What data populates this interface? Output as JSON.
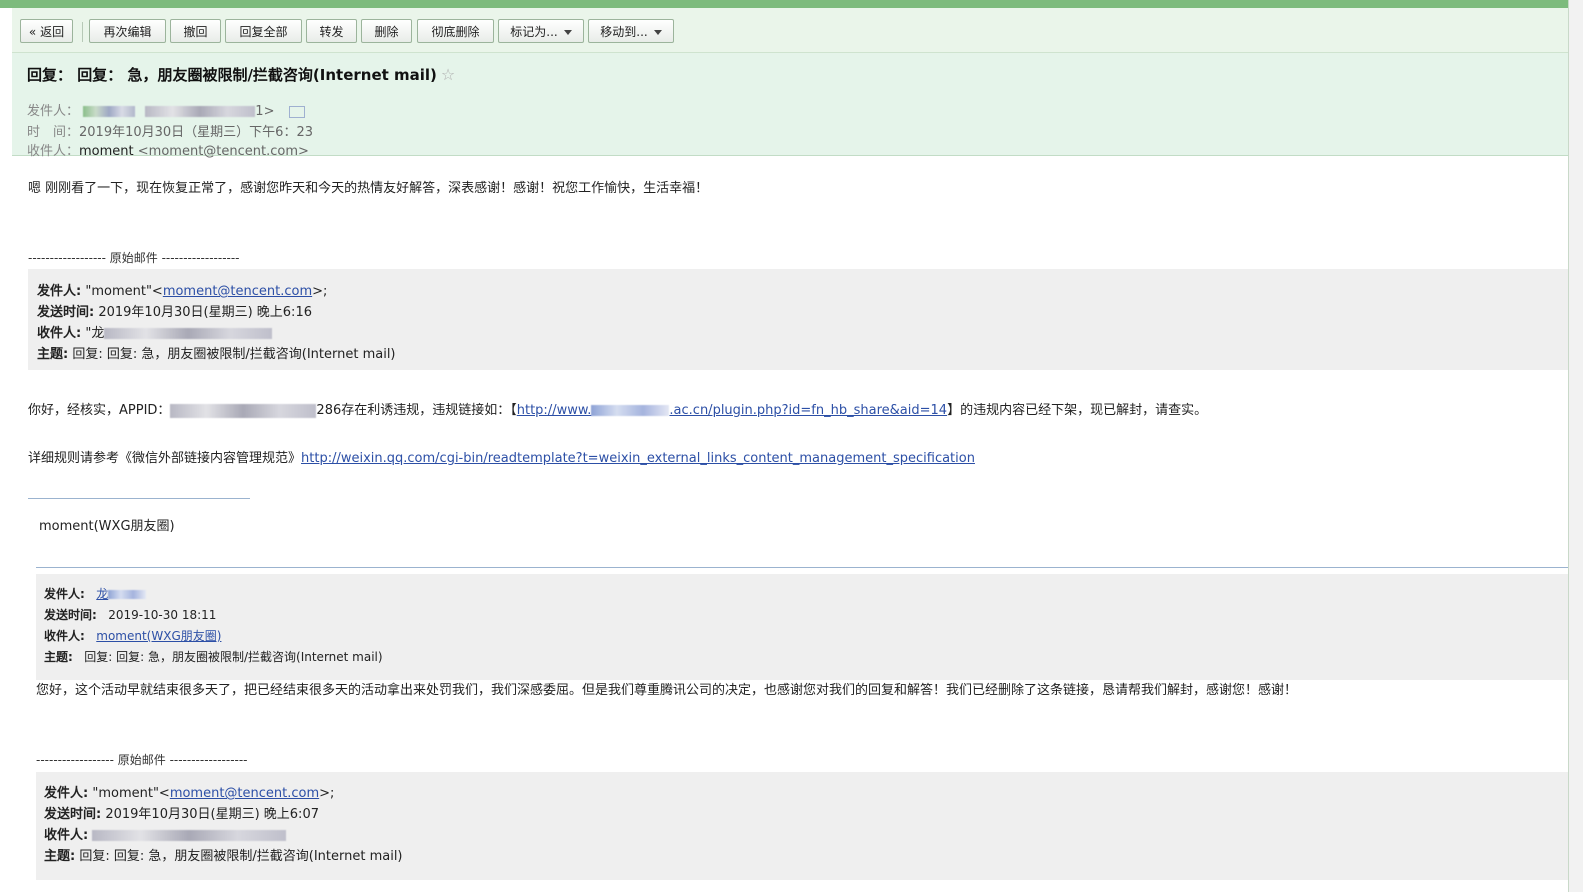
{
  "toolbar": {
    "back": "« 返回",
    "reedit": "再次编辑",
    "recall": "撤回",
    "reply_all": "回复全部",
    "forward": "转发",
    "delete": "删除",
    "delete_perm": "彻底删除",
    "mark_as": "标记为...",
    "move_to": "移动到..."
  },
  "header": {
    "subject": "回复：  回复：  急，朋友圈被限制/拦截咨询(Internet mail)",
    "star": "☆",
    "from_label": "发件人：",
    "from_tail": "1>",
    "time_label": "时　间：",
    "time_value": "2019年10月30日（星期三）下午6：23",
    "to_label": "收件人：",
    "to_name": "moment",
    "to_addr": "<moment@tencent.com>"
  },
  "body": {
    "reply_text": "嗯  刚刚看了一下，现在恢复正常了，感谢您昨天和今天的热情友好解答，深表感谢！感谢！祝您工作愉快，生活幸福！",
    "orig_sep": "------------------ 原始邮件 ------------------",
    "quote1": {
      "from_label": "发件人:",
      "from_name": "\"moment\"<",
      "from_email": "moment@tencent.com",
      "from_tail": ">;",
      "sent_label": "发送时间:",
      "sent_value": "2019年10月30日(星期三) 晚上6:16",
      "to_label": "收件人:",
      "to_prefix": "\"龙",
      "subject_label": "主题:",
      "subject_value": "回复: 回复:  急，朋友圈被限制/拦截咨询(Internet mail)"
    },
    "p1_prefix": "你好，经核实，APPID：",
    "p1_mid": "286存在利诱违规，违规链接如：【",
    "p1_link_a": "http://www.",
    "p1_link_b": ".ac.cn/plugin.php?id=fn_hb_share&aid=14",
    "p1_suffix": "】的违规内容已经下架，现已解封，请查实。",
    "p2_prefix": "详细规则请参考《微信外部链接内容管理规范》",
    "p2_link": "http://weixin.qq.com/cgi-bin/readtemplate?t=weixin_external_links_content_management_specification",
    "signature": "moment(WXG朋友圈)",
    "quote2": {
      "from_label": "发件人:",
      "from_link": "龙",
      "sent_label": "发送时间:",
      "sent_value": "2019-10-30 18:11",
      "to_label": "收件人:",
      "to_link": "moment(WXG朋友圈)",
      "subject_label": "主题:",
      "subject_value": "回复:  回复:  急，朋友圈被限制/拦截咨询(Internet mail)"
    },
    "p3": "您好，这个活动早就结束很多天了，把已经结束很多天的活动拿出来处罚我们，我们深感委屈。但是我们尊重腾讯公司的决定，也感谢您对我们的回复和解答！我们已经删除了这条链接，恳请帮我们解封，感谢您！感谢！",
    "orig_sep2": "------------------ 原始邮件 ------------------",
    "quote3": {
      "from_label": "发件人:",
      "from_name": "\"moment\"<",
      "from_email": "moment@tencent.com",
      "from_tail": ">;",
      "sent_label": "发送时间:",
      "sent_value": "2019年10月30日(星期三) 晚上6:07",
      "to_label": "收件人:",
      "subject_label": "主题:",
      "subject_value": "回复: 回复:  急，朋友圈被限制/拦截咨询(Internet mail)"
    }
  }
}
